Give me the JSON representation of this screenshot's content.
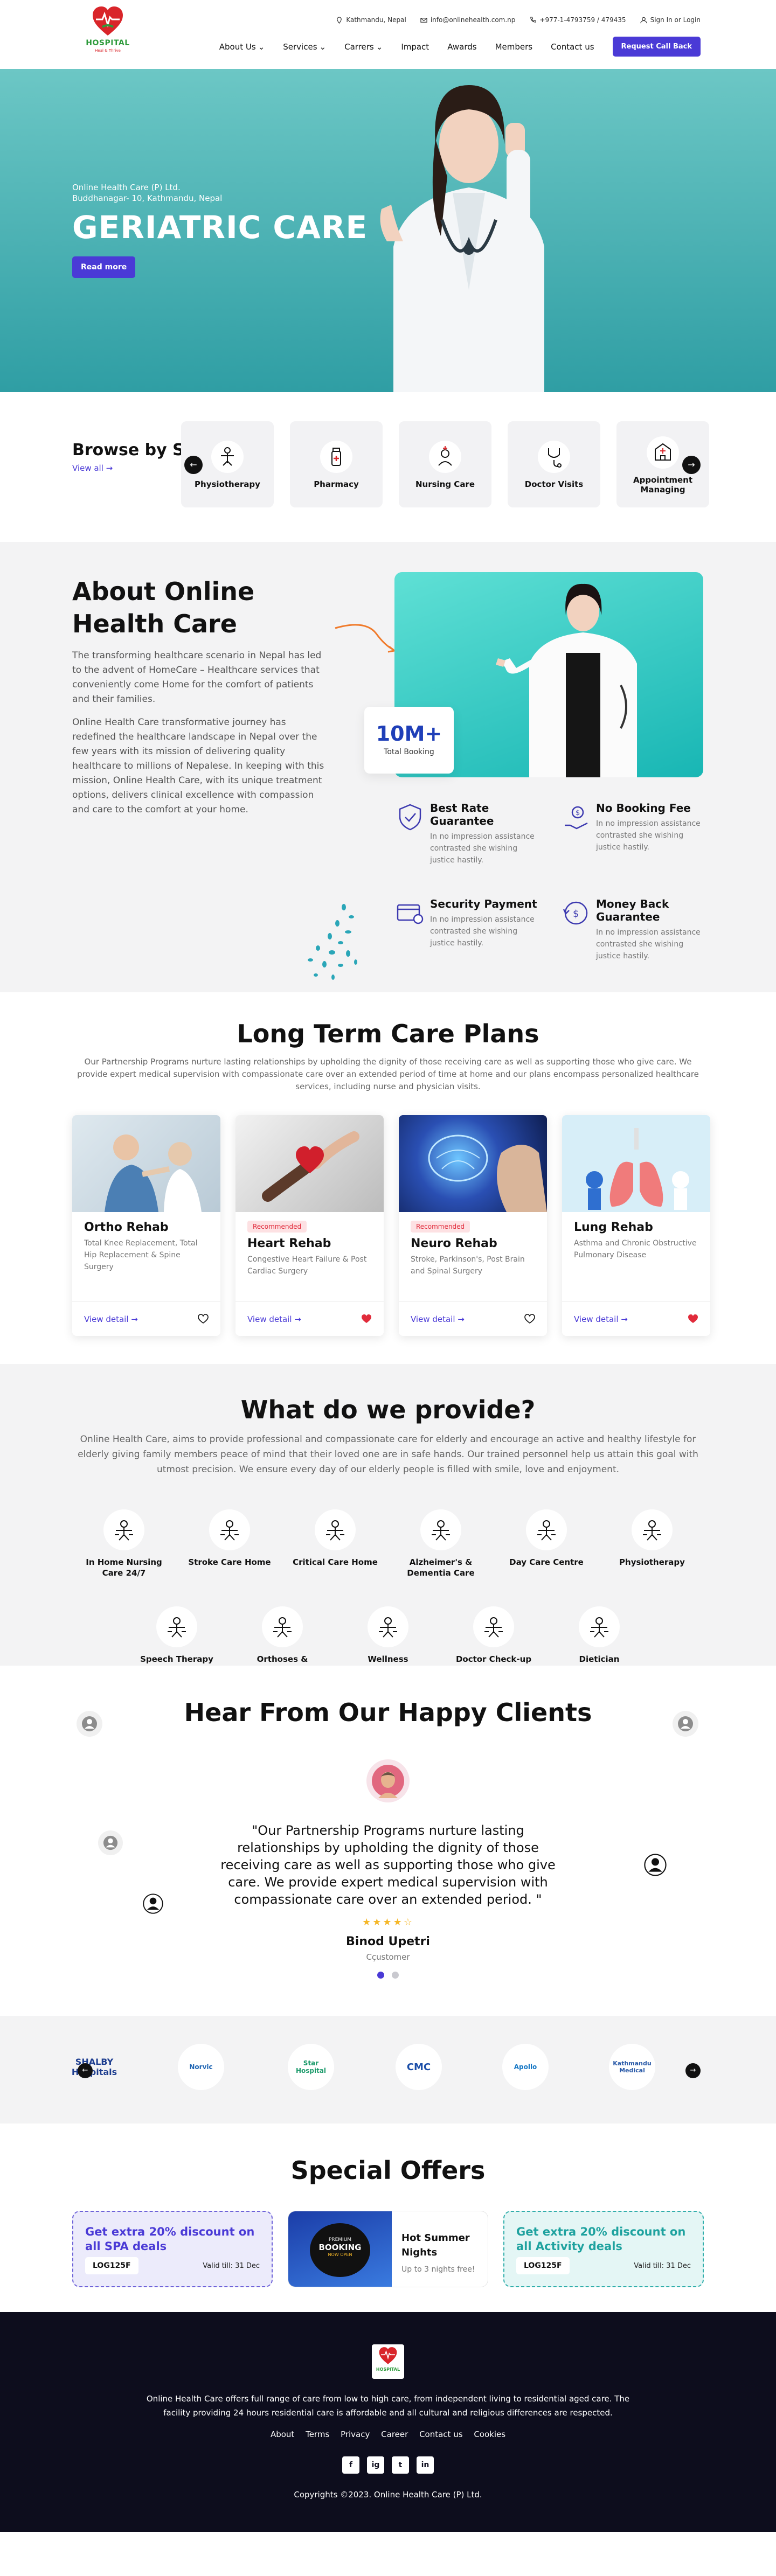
{
  "header": {
    "logo_text": "HOSPITAL",
    "logo_tagline": "Heal & Thrive",
    "location": "Kathmandu, Nepal",
    "email": "info@onlinehealth.com.np",
    "phone": "+977-1-4793759 / 479435",
    "signin": "Sign In or Login",
    "nav": [
      "About Us",
      "Services",
      "Carrers",
      "Impact",
      "Awards",
      "Members",
      "Contact us"
    ],
    "cta": "Request Call Back"
  },
  "hero": {
    "company": "Online Health Care (P) Ltd.",
    "address": "Buddhanagar- 10, Kathmandu, Nepal",
    "title": "GERIATRIC CARE",
    "button": "Read more"
  },
  "browse": {
    "title": "Browse by Services",
    "view_all": "View all →",
    "services": [
      "Physiotherapy",
      "Pharmacy",
      "Nursing Care",
      "Doctor Visits",
      "Appointment Managing"
    ]
  },
  "about": {
    "title": "About Online Health Care",
    "para1": "The transforming healthcare scenario in Nepal has led to the advent of HomeCare – Healthcare services that conveniently come Home for the comfort of patients and their families.",
    "para2": "Online Health Care transformative journey has redefined the healthcare landscape in Nepal over the few years with its mission of delivering quality healthcare to millions of Nepalese. In keeping with this mission, Online Health Care, with its unique treatment options, delivers clinical excellence with compassion and care to the comfort at your home.",
    "stat_value": "10M+",
    "stat_label": "Total Booking",
    "features": [
      {
        "title": "Best Rate Guarantee",
        "text": "In no impression assistance contrasted she wishing justice hastily."
      },
      {
        "title": "No Booking Fee",
        "text": "In no impression assistance contrasted she wishing justice hastily."
      },
      {
        "title": "Security Payment",
        "text": "In no impression assistance contrasted she wishing justice hastily."
      },
      {
        "title": "Money Back Guarantee",
        "text": "In no impression assistance contrasted she wishing justice hastily."
      }
    ]
  },
  "plans": {
    "title": "Long Term Care Plans",
    "subtitle": "Our Partnership Programs nurture lasting relationships by upholding the dignity of those receiving care as well as supporting those who give care. We provide expert medical supervision with compassionate care over an extended period of time at home and our plans encompass personalized healthcare services, including nurse and physician visits.",
    "view_detail": "View detail →",
    "items": [
      {
        "name": "Ortho Rehab",
        "badge": "",
        "desc": "Total Knee Replacement, Total Hip Replacement & Spine Surgery",
        "liked": false
      },
      {
        "name": "Heart Rehab",
        "badge": "Recommended",
        "desc": "Congestive Heart Failure & Post Cardiac Surgery",
        "liked": true
      },
      {
        "name": "Neuro Rehab",
        "badge": "Recommended",
        "desc": "Stroke, Parkinson's, Post Brain and Spinal Surgery",
        "liked": false
      },
      {
        "name": "Lung Rehab",
        "badge": "",
        "desc": "Asthma and Chronic Obstructive Pulmonary Disease",
        "liked": true
      }
    ]
  },
  "provide": {
    "title": "What do we provide?",
    "text": "Online Health Care, aims to provide professional and compassionate care for elderly and encourage an active and healthy lifestyle for elderly giving family members peace of mind that their loved one are in safe hands. Our trained personnel help us attain this goal with utmost precision. We ensure every day of our elderly people is filled with smile, love and enjoyment.",
    "items": [
      "In Home Nursing Care 24/7",
      "Stroke Care Home",
      "Critical Care Home",
      "Alzheimer's & Dementia Care",
      "Day Care Centre",
      "Physiotherapy",
      "Speech Therapy",
      "Orthoses & Prostheses",
      "Wellness",
      "Doctor Check-up",
      "Dietician Consultation"
    ]
  },
  "clients": {
    "title": "Hear From Our Happy Clients",
    "quote": "\"Our Partnership Programs nurture lasting relationships by upholding the dignity of those receiving care as well as supporting those who give care. We provide expert medical supervision with compassionate care over an extended period. \"",
    "rating": 4.5,
    "stars": "★★★★☆",
    "name": "Binod Upetri",
    "role": "Cçustomer"
  },
  "partners": [
    "SHALBY Hospitals",
    "Norvic",
    "Star Hospital",
    "CMC",
    "Apollo",
    "Kathmandu Medical"
  ],
  "offers": {
    "title": "Special Offers",
    "spa": {
      "title": "Get extra 20% discount on all SPA deals",
      "code": "LOG125F",
      "valid": "Valid till: 31 Dec"
    },
    "summer": {
      "badge_top": "PREMIUM",
      "badge_main": "BOOKING",
      "badge_sub": "NOW OPEN",
      "title": "Hot Summer Nights",
      "text": "Up to 3 nights free!"
    },
    "activity": {
      "title": "Get extra 20% discount on all Activity deals",
      "code": "LOG125F",
      "valid": "Valid till: 31 Dec"
    }
  },
  "footer": {
    "logo_text": "HOSPITAL",
    "description": "Online Health Care offers full range of care from low to high care, from independent living to residential aged care. The facility providing 24 hours residential care is affordable and all cultural and religious differences are respected.",
    "links": [
      "About",
      "Terms",
      "Privacy",
      "Career",
      "Contact us",
      "Cookies"
    ],
    "social": [
      "f",
      "ig",
      "t",
      "in"
    ],
    "copyright": "Copyrights ©2023. Online Health Care (P) Ltd."
  },
  "colors": {
    "primary": "#4a3ad6",
    "teal": "#2fa3a8",
    "dark": "#0d0d1d",
    "accent_red": "#e12b3b"
  }
}
